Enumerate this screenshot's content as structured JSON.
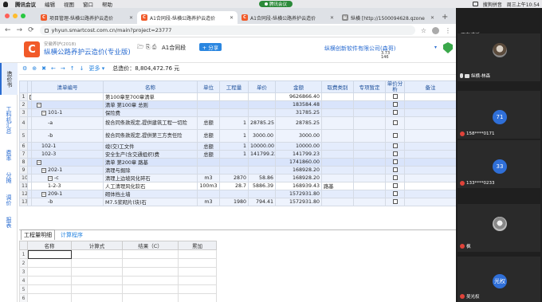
{
  "menubar": {
    "app": "腾讯会议",
    "items": [
      "编辑",
      "视图",
      "窗口",
      "帮助"
    ],
    "meeting_pill": "腾讯会议",
    "input_method": "搜狗拼音",
    "clock": "周三上午10:54"
  },
  "browser": {
    "tabs": [
      {
        "favicon": "C",
        "title": "项目管理-纵横公路养护云造价"
      },
      {
        "favicon": "C",
        "title": "A1合同段-纵横公路养护云造价"
      },
      {
        "favicon": "C",
        "title": "A1合同段-纵横公路养护云造价"
      },
      {
        "favicon": "纵",
        "title": "纵横 [http://1500094628.qzone"
      }
    ],
    "url": "yhyun.smartcost.com.cn/main?project=23777"
  },
  "app": {
    "logo": "C",
    "subtitle": "安徽养护(2018)",
    "name": "纵横公路养护云造价(专业版)",
    "toolbar_icons": "🗁 ⎘ ⎙",
    "contract": "A1合同段",
    "share": "+ 分享",
    "company": "纵横创新软件有限公司(森哥)",
    "cursor_info": "3.73\n146"
  },
  "leftnav": [
    "造价书",
    "工料机汇总",
    "费率",
    "分摊",
    "调价",
    "报表"
  ],
  "table_toolbar": {
    "more": "更多",
    "total_label": "总造价：",
    "total_value": "8,804,472.76 元"
  },
  "grid": {
    "columns": [
      "清单编号",
      "名称",
      "单位",
      "工程量",
      "单价",
      "金额",
      "取费类别",
      "专项暂定",
      "单价分析",
      "备注"
    ],
    "rows": [
      {
        "n": "1",
        "code": "",
        "name": "第100章至700章清单",
        "unit": "",
        "qty": "",
        "price": "",
        "amount": "9626866.40",
        "lvl": "lvl0",
        "tg": "−"
      },
      {
        "n": "2",
        "code": "",
        "name": "清单 第100章 总则",
        "unit": "",
        "qty": "",
        "price": "",
        "amount": "183584.48",
        "lvl": "lvl1",
        "tg": "−"
      },
      {
        "n": "3",
        "code": "101-1",
        "name": "保险费",
        "unit": "",
        "qty": "",
        "price": "",
        "amount": "31785.25",
        "lvl": "lvl2",
        "tg": "−"
      },
      {
        "n": "4",
        "code": "-a",
        "name": "按合同条款规定,提供建筑工程一切险",
        "unit": "总额",
        "qty": "1",
        "price": "28785.25",
        "amount": "28785.25",
        "lvl": "lvl3",
        "tall": true
      },
      {
        "n": "5",
        "code": "-b",
        "name": "按合同条款规定,提供第三方责任险",
        "unit": "总额",
        "qty": "1",
        "price": "3000.00",
        "amount": "3000.00",
        "lvl": "lvl3",
        "tall": true
      },
      {
        "n": "6",
        "code": "102-1",
        "name": "竣(交)工文件",
        "unit": "总额",
        "qty": "1",
        "price": "10000.00",
        "amount": "10000.00",
        "lvl": "lvl2"
      },
      {
        "n": "7",
        "code": "102-3",
        "name": "安全生产(含交通组织)费",
        "unit": "总额",
        "qty": "1",
        "price": "141799.23",
        "amount": "141799.23",
        "lvl": "lvl2"
      },
      {
        "n": "8",
        "code": "",
        "name": "清单 第200章 路基",
        "unit": "",
        "qty": "",
        "price": "",
        "amount": "1741860.00",
        "lvl": "lvl1",
        "tg": "−"
      },
      {
        "n": "9",
        "code": "202-1",
        "name": "清理与掘除",
        "unit": "",
        "qty": "",
        "price": "",
        "amount": "168928.20",
        "lvl": "lvl2",
        "tg": "−"
      },
      {
        "n": "10",
        "code": "-c",
        "name": "清理上边坡风化碎石",
        "unit": "m3",
        "qty": "2870",
        "price": "58.86",
        "amount": "168928.20",
        "lvl": "lvl3",
        "tg": "−"
      },
      {
        "n": "11",
        "code": "1-2-3",
        "name": "人工清理风化软石",
        "unit": "100m3",
        "qty": "28.7",
        "price": "5886.39",
        "amount": "168939.43",
        "fee": "路基",
        "lvl": "sel"
      },
      {
        "n": "12",
        "code": "209-1",
        "name": "砌体挡土墙",
        "unit": "",
        "qty": "",
        "price": "",
        "amount": "1572931.80",
        "lvl": "lvl2",
        "tg": "−"
      },
      {
        "n": "13",
        "code": "-b",
        "name": "M7.5浆砌片(块)石",
        "unit": "m3",
        "qty": "1980",
        "price": "794.41",
        "amount": "1572931.80",
        "lvl": "lvl3"
      }
    ]
  },
  "bottom": {
    "tabs": [
      "工程量明细",
      "计算程序"
    ],
    "columns": [
      "名称",
      "计算式",
      "结果（C）",
      "累加"
    ],
    "row_numbers": [
      "1",
      "2",
      "3",
      "4",
      "5",
      "6"
    ]
  },
  "meeting": {
    "speaking": "正在讲话:",
    "participants": [
      {
        "name": "纵横-林森",
        "avatar": "",
        "color": "#6b5a48"
      },
      {
        "name": "158****0171",
        "avatar": "71",
        "color": "#2f6fd8"
      },
      {
        "name": "133****0233",
        "avatar": "33",
        "color": "#2f6fd8"
      },
      {
        "name": "枫",
        "avatar": "",
        "color": "#888"
      },
      {
        "name": "吴光权",
        "avatar": "光权",
        "color": "#2f6fd8"
      }
    ]
  }
}
